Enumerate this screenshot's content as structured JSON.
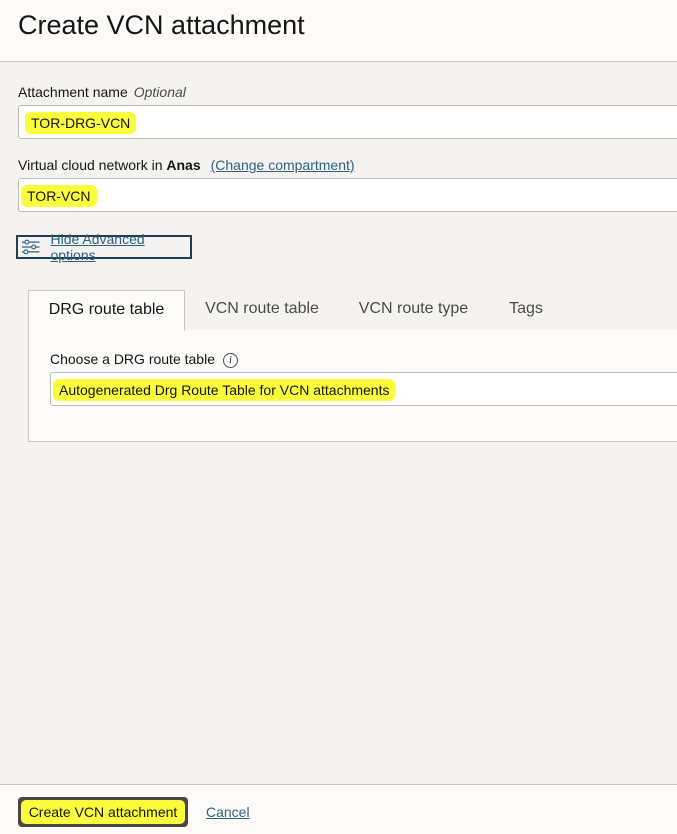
{
  "header": {
    "title": "Create VCN attachment"
  },
  "form": {
    "attachment_name": {
      "label": "Attachment name",
      "optional": "Optional",
      "value": "TOR-DRG-VCN"
    },
    "vcn": {
      "label_prefix": "Virtual cloud network in",
      "compartment": "Anas",
      "change_link": "(Change compartment)",
      "value": "TOR-VCN"
    },
    "advanced_toggle": {
      "label": "Hide Advanced options",
      "icon": "sliders-icon"
    }
  },
  "advanced": {
    "tabs": [
      {
        "label": "DRG route table",
        "active": true
      },
      {
        "label": "VCN route table",
        "active": false
      },
      {
        "label": "VCN route type",
        "active": false
      },
      {
        "label": "Tags",
        "active": false
      }
    ],
    "drg_route_table": {
      "label": "Choose a DRG route table",
      "info_icon": "info-icon",
      "value": "Autogenerated Drg Route Table for VCN attachments"
    }
  },
  "footer": {
    "primary_label": "Create VCN attachment",
    "cancel_label": "Cancel"
  },
  "colors": {
    "highlight": "#fafc3c",
    "primary_button": "#4b4742",
    "link": "#2d6380"
  }
}
